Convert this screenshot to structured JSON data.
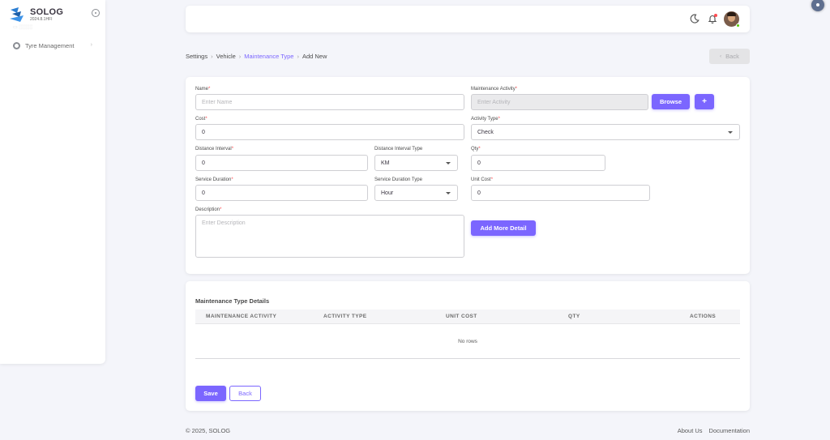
{
  "brand": {
    "name": "SOLOG",
    "version": "2024.8.1HFI"
  },
  "sidebar": {
    "items": [
      {
        "label": "Tyre Management",
        "icon": "tyre-icon"
      }
    ]
  },
  "breadcrumb": {
    "items": [
      "Settings",
      "Vehicle",
      "Maintenance Type",
      "Add New"
    ]
  },
  "header_actions": {
    "back_label": "Back"
  },
  "form": {
    "name": {
      "label": "Name",
      "placeholder": "Enter Name",
      "value": ""
    },
    "maintenance_activity": {
      "label": "Maintenance Activity",
      "placeholder": "Enter Activity",
      "value": ""
    },
    "browse_label": "Browse",
    "add_icon": "+",
    "cost": {
      "label": "Cost",
      "value": "0"
    },
    "activity_type": {
      "label": "Activity Type",
      "value": "Check"
    },
    "distance_interval": {
      "label": "Distance Interval",
      "value": "0"
    },
    "distance_interval_type": {
      "label": "Distance Interval Type",
      "value": "KM"
    },
    "qty": {
      "label": "Qty",
      "value": "0"
    },
    "service_duration": {
      "label": "Service Duration",
      "value": "0"
    },
    "service_duration_type": {
      "label": "Service Duration Type",
      "value": "Hour"
    },
    "unit_cost": {
      "label": "Unit Cost",
      "value": "0"
    },
    "description": {
      "label": "Description",
      "placeholder": "Enter Description"
    },
    "add_more_label": "Add More Detail"
  },
  "details": {
    "title": "Maintenance Type Details",
    "columns": [
      "MAINTENANCE ACTIVITY",
      "ACTIVITY TYPE",
      "UNIT COST",
      "QTY",
      "ACTIONS"
    ],
    "empty_text": "No rows",
    "save_label": "Save",
    "back_label": "Back"
  },
  "footer": {
    "copyright": "© 2025, SOLOG",
    "links": [
      "About Us",
      "Documentation"
    ]
  },
  "colors": {
    "primary": "#7b66ff",
    "required": "#ff4c51",
    "status_online": "#56ca00"
  }
}
